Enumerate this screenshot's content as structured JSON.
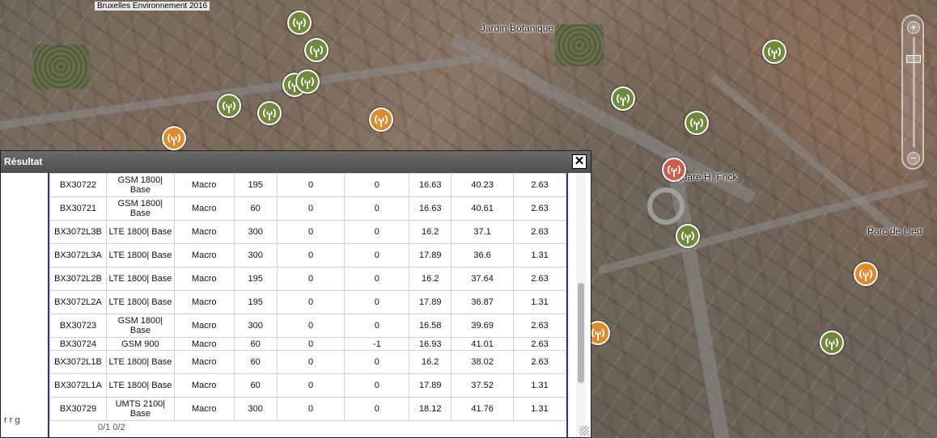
{
  "map": {
    "credit": "Bruxelles Environnement 2016",
    "labels": {
      "jardin": "Jardin Botanique",
      "square": "Square H. Frick",
      "parc": "Parc de Lied"
    },
    "zoom_in": "+",
    "zoom_out": "−"
  },
  "panel": {
    "title": "Résultat",
    "close": "✕",
    "peek_left": "r r g",
    "peek_bottom": "0/1      0/2",
    "rows": [
      [
        "BX30722",
        "GSM 1800| Base",
        "Macro",
        "195",
        "0",
        "0",
        "16.63",
        "40.23",
        "2.63"
      ],
      [
        "BX30721",
        "GSM 1800| Base",
        "Macro",
        "60",
        "0",
        "0",
        "16.63",
        "40.61",
        "2.63"
      ],
      [
        "BX3072L3B",
        "LTE 1800| Base",
        "Macro",
        "300",
        "0",
        "0",
        "16.2",
        "37.1",
        "2.63"
      ],
      [
        "BX3072L3A",
        "LTE 1800| Base",
        "Macro",
        "300",
        "0",
        "0",
        "17.89",
        "36.6",
        "1.31"
      ],
      [
        "BX3072L2B",
        "LTE 1800| Base",
        "Macro",
        "195",
        "0",
        "0",
        "16.2",
        "37.64",
        "2.63"
      ],
      [
        "BX3072L2A",
        "LTE 1800| Base",
        "Macro",
        "195",
        "0",
        "0",
        "17.89",
        "36.87",
        "1.31"
      ],
      [
        "BX30723",
        "GSM 1800| Base",
        "Macro",
        "300",
        "0",
        "0",
        "16.58",
        "39.69",
        "2.63"
      ],
      [
        "BX30724",
        "GSM 900",
        "Macro",
        "60",
        "0",
        "-1",
        "16.93",
        "41.01",
        "2.63"
      ],
      [
        "BX3072L1B",
        "LTE 1800| Base",
        "Macro",
        "60",
        "0",
        "0",
        "16.2",
        "38.02",
        "2.63"
      ],
      [
        "BX3072L1A",
        "LTE 1800| Base",
        "Macro",
        "60",
        "0",
        "0",
        "17.89",
        "37.52",
        "1.31"
      ],
      [
        "BX30729",
        "UMTS 2100| Base",
        "Macro",
        "300",
        "0",
        "0",
        "18.12",
        "41.76",
        "1.31"
      ]
    ]
  },
  "colors": {
    "marker_green": "#6e8a3a",
    "marker_orange": "#e08a2c",
    "table_border": "#2d2db5"
  },
  "icons": {
    "marker": "antenna-icon",
    "close": "close-icon"
  }
}
